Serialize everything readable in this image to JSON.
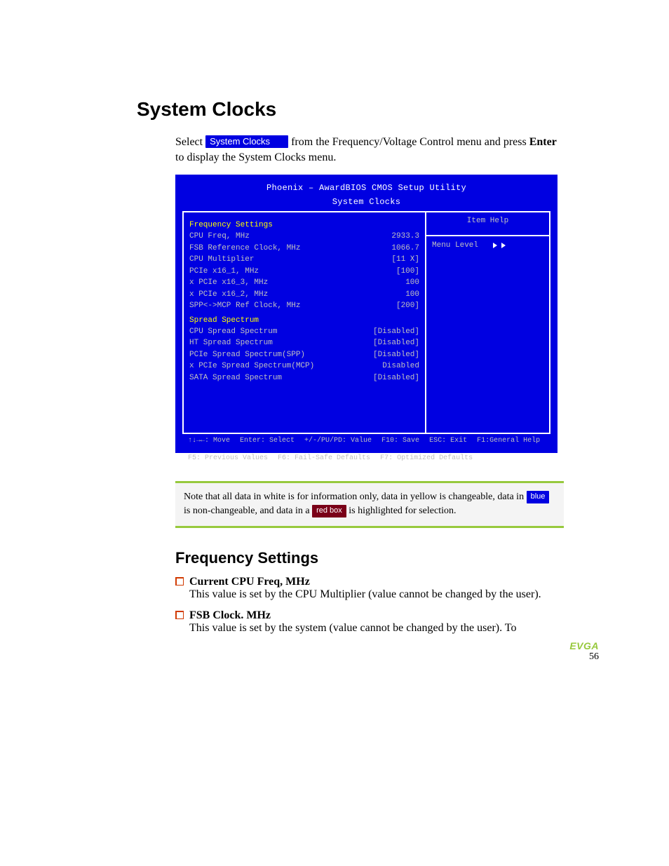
{
  "title": "System Clocks",
  "intro": {
    "pre": "Select",
    "highlight": "System Clocks",
    "mid": "from the Frequency/Voltage Control menu and press",
    "enter": "Enter",
    "tail": "to display the System Clocks menu."
  },
  "bios": {
    "utility_line": "Phoenix – AwardBIOS CMOS Setup Utility",
    "menu_title": "System Clocks",
    "help_title": "Item Help",
    "help_menu_level": "Menu Level",
    "help_arrow": "▸▸",
    "sections": [
      {
        "heading": "Frequency Settings",
        "rows": [
          {
            "label": "CPU Freq, MHz",
            "value": "2933.3"
          },
          {
            "label": "FSB Reference Clock, MHz",
            "value": "1066.7"
          },
          {
            "label": "CPU Multiplier",
            "value": "[11 X]"
          },
          {
            "label": "PCIe x16_1, MHz",
            "value": "[100]"
          },
          {
            "label": "x PCIe x16_3, MHz",
            "value": "100"
          },
          {
            "label": "x PCIe x16_2, MHz",
            "value": "100"
          },
          {
            "label": "SPP<->MCP Ref Clock, MHz",
            "value": "[200]"
          }
        ]
      },
      {
        "heading": "Spread Spectrum",
        "rows": [
          {
            "label": "CPU Spread Spectrum",
            "value": "[Disabled]"
          },
          {
            "label": "HT  Spread Spectrum",
            "value": "[Disabled]"
          },
          {
            "label": "PCIe Spread Spectrum(SPP)",
            "value": "[Disabled]"
          },
          {
            "label": "x PCIe Spread Spectrum(MCP)",
            "value": "Disabled"
          },
          {
            "label": "SATA  Spread Spectrum",
            "value": "[Disabled]"
          }
        ]
      }
    ],
    "footer": [
      "↑↓→←: Move",
      "Enter: Select",
      "+/-/PU/PD: Value",
      "F10: Save",
      "ESC: Exit",
      "F1:General Help",
      "F5: Previous Values",
      "F6: Fail-Safe Defaults",
      "F7: Optimized Defaults"
    ]
  },
  "note": {
    "line1_pre": "Note that all data in white is for information only, data in yellow is changeable, data in",
    "blue_chip": "blue",
    "line1_mid": "is non-changeable, and data in a",
    "red_chip": "red box",
    "line1_post": "is highlighted for selection."
  },
  "subsection_title": "Frequency Settings",
  "items": [
    {
      "head": "Current CPU Freq, MHz",
      "body": "This value is set by the CPU Multiplier (value cannot be changed by the user)."
    },
    {
      "head": "FSB Clock. MHz",
      "body": "This value is set by the system (value cannot be changed by the user). To"
    }
  ],
  "footer": {
    "brand": "EVGA",
    "page_number": "56"
  }
}
